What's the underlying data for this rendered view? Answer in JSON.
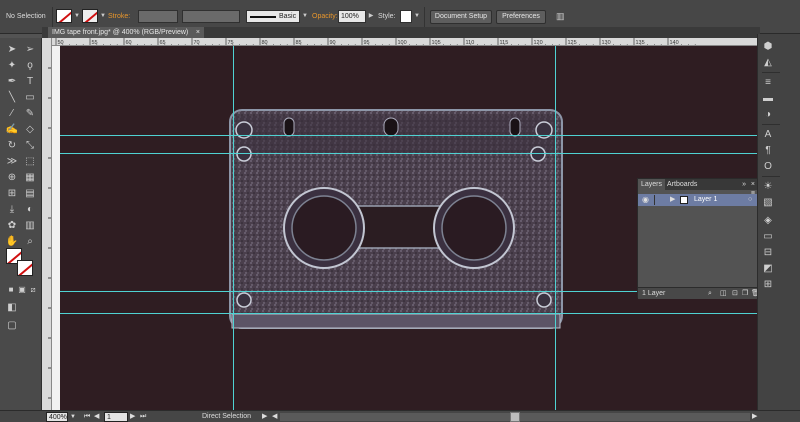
{
  "control_bar": {
    "selection_text": "No Selection",
    "fill_swatch": "fill-none-swatch",
    "stroke_swatch": "stroke-none-swatch",
    "stroke_label": "Stroke:",
    "stroke_weight": "",
    "brush_value": "Basic",
    "opacity_label": "Opacity:",
    "opacity_value": "100%",
    "style_label": "Style:",
    "document_setup_label": "Document Setup",
    "preferences_label": "Preferences"
  },
  "document_tab": {
    "title": "IMG tape front.jpg* @ 400% (RGB/Preview)",
    "close": "×"
  },
  "ruler_top": {
    "labels": [
      "50",
      "55",
      "60",
      "65",
      "70",
      "75",
      "80",
      "85",
      "90",
      "95",
      "100",
      "105",
      "110",
      "115",
      "120",
      "125",
      "130",
      "135",
      "140"
    ]
  },
  "layers_panel": {
    "tabs": [
      "Layers",
      "Artboards"
    ],
    "layer_name": "Layer 1",
    "footer_text": "1 Layer"
  },
  "status_bar": {
    "zoom_value": "400%",
    "artboard_value": "1",
    "tool_status": "Direct Selection"
  },
  "toolbar": {
    "tools": [
      "selection-tool-icon",
      "direct-selection-tool-icon",
      "magic-wand-tool-icon",
      "lasso-tool-icon",
      "pen-tool-icon",
      "type-tool-icon",
      "line-segment-tool-icon",
      "rectangle-tool-icon",
      "paintbrush-tool-icon",
      "pencil-tool-icon",
      "blob-brush-tool-icon",
      "eraser-tool-icon",
      "rotate-tool-icon",
      "scale-tool-icon",
      "width-tool-icon",
      "free-transform-tool-icon",
      "shape-builder-tool-icon",
      "perspective-grid-tool-icon",
      "mesh-tool-icon",
      "gradient-tool-icon",
      "eyedropper-tool-icon",
      "blend-tool-icon",
      "symbol-sprayer-tool-icon",
      "column-graph-tool-icon",
      "artboard-tool-icon",
      "slice-tool-icon",
      "hand-tool-icon",
      "zoom-tool-icon"
    ]
  },
  "colors": {
    "canvas_bg": "#2f1d22",
    "guide": "#4fd2d2",
    "accent_orange": "#e8962c",
    "layer_highlight": "#6d7ca3"
  }
}
